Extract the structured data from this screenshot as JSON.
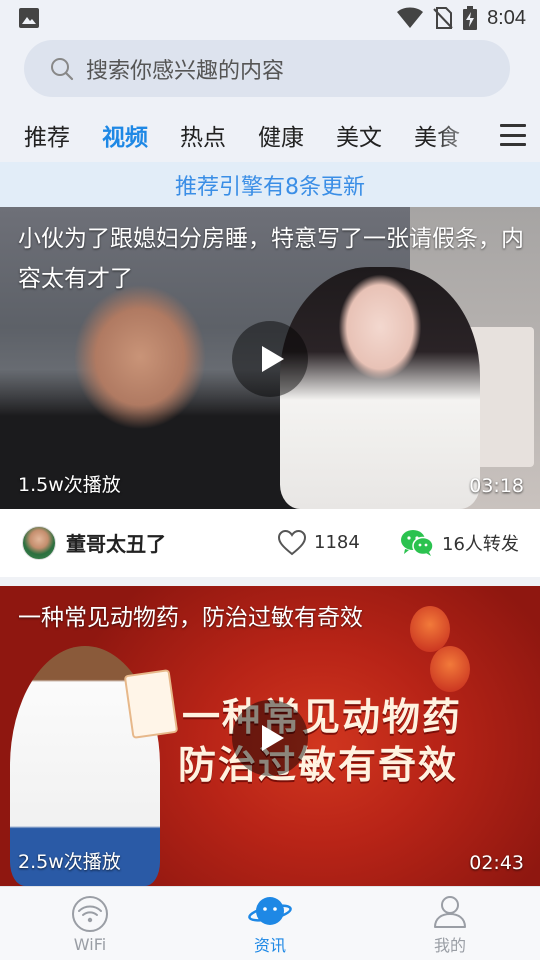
{
  "status_bar": {
    "time": "8:04"
  },
  "search": {
    "placeholder": "搜索你感兴趣的内容"
  },
  "tabs": [
    {
      "label": "推荐",
      "active": false
    },
    {
      "label": "视频",
      "active": true
    },
    {
      "label": "热点",
      "active": false
    },
    {
      "label": "健康",
      "active": false
    },
    {
      "label": "美文",
      "active": false
    },
    {
      "label": "美食",
      "active": false
    }
  ],
  "banner": {
    "text": "推荐引擎有8条更新"
  },
  "feed": [
    {
      "title": "小伙为了跟媳妇分房睡，特意写了一张请假条，内容太有才了",
      "views": "1.5w次播放",
      "duration": "03:18",
      "author": "董哥太丑了",
      "likes": "1184",
      "shares": "16人转发"
    },
    {
      "title": "一种常见动物药，防治过敏有奇效",
      "overlay_line1": "一种常见动物药",
      "overlay_line2": "防治过敏有奇效",
      "views": "2.5w次播放",
      "duration": "02:43"
    }
  ],
  "bottom_nav": [
    {
      "label": "WiFi",
      "icon": "wifi-icon",
      "active": false
    },
    {
      "label": "资讯",
      "icon": "planet-icon",
      "active": true
    },
    {
      "label": "我的",
      "icon": "person-icon",
      "active": false
    }
  ],
  "colors": {
    "accent": "#1e88e5",
    "banner_text": "#3a8ee6",
    "header_bg": "#eef1f7"
  }
}
